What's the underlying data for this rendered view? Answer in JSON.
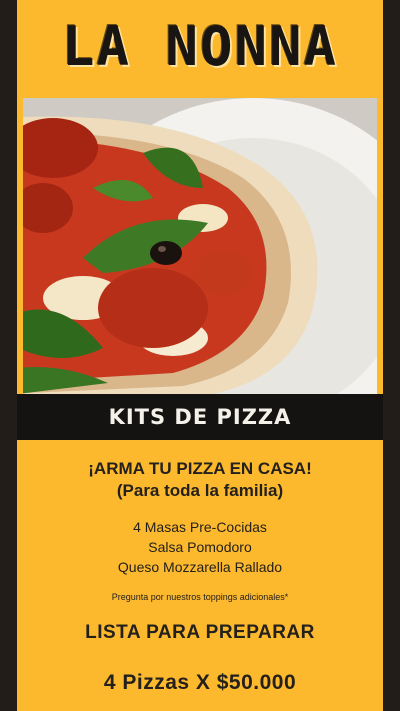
{
  "brand": {
    "name": "LA NONNA"
  },
  "photo": {
    "subject": "pizza-photo"
  },
  "banner": {
    "label": "KITS DE PIZZA"
  },
  "headline": {
    "line1": "¡ARMA TU PIZZA EN CASA!",
    "line2": "(Para toda la familia)"
  },
  "items": [
    "4 Masas Pre-Cocidas",
    "Salsa Pomodoro",
    "Queso Mozzarella Rallado"
  ],
  "note": "Pregunta por nuestros toppings adicionales*",
  "ready": "LISTA PARA PREPARAR",
  "price": "4 Pizzas X $50.000",
  "colors": {
    "background": "#fdb92e",
    "banner": "#151311",
    "text": "#24201b"
  }
}
